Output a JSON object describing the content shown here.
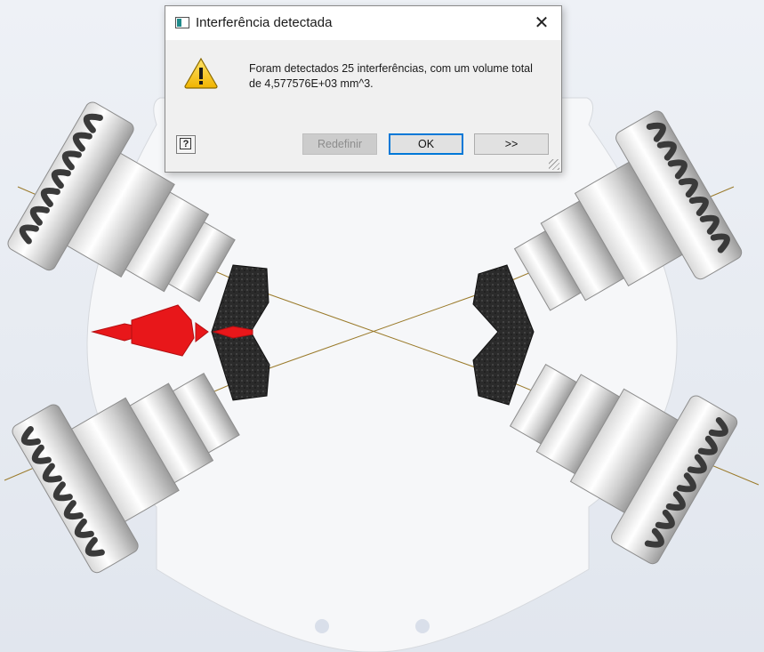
{
  "dialog": {
    "title": "Interferência detectada",
    "close_glyph": "✕",
    "message_line1": "Foram detectados 25 interferências, com um volume total",
    "message_line2": "de 4,577576E+03 mm^3.",
    "help_glyph": "?",
    "buttons": {
      "reset": "Redefinir",
      "ok": "OK",
      "more": ">>"
    },
    "icons": {
      "title": "application-icon",
      "warning": "warning-icon",
      "help": "help-icon"
    }
  },
  "viewport": {
    "background_color": "#e4e9f1",
    "plate_color": "#f7f8fa",
    "interference_color": "#e8171a",
    "foam_color": "#2a2a2a",
    "guide_line_color": "#9a7a2a"
  }
}
